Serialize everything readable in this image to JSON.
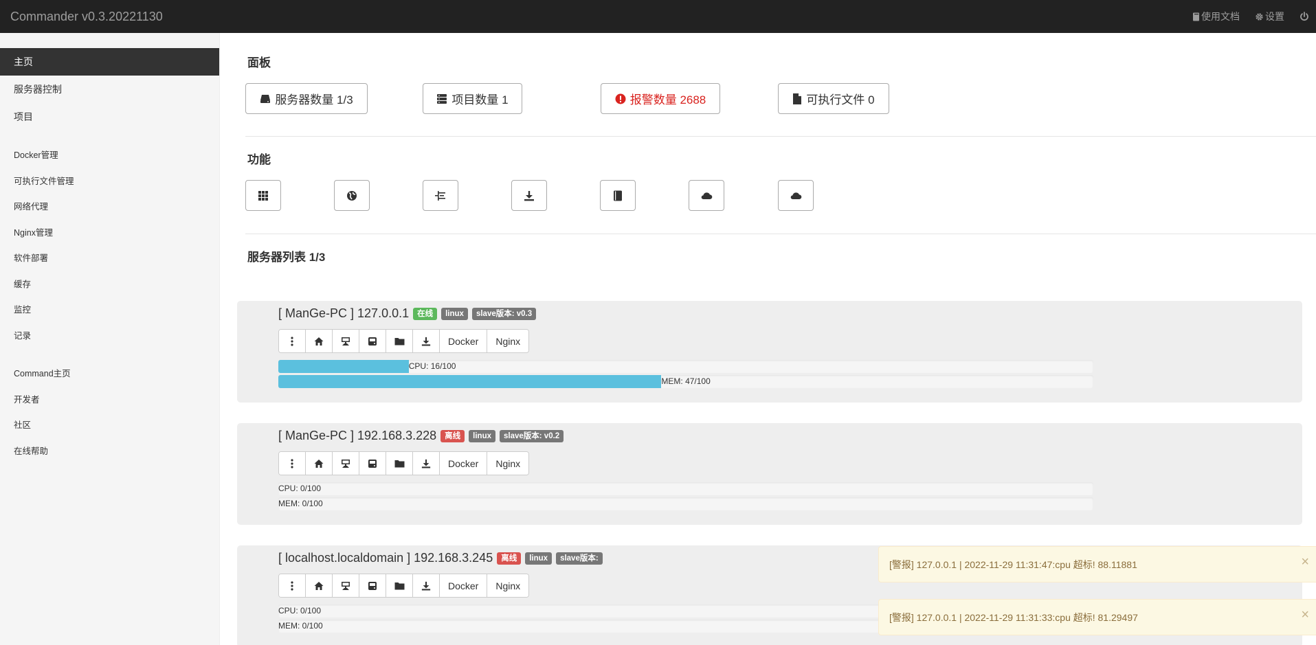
{
  "header": {
    "title": "Commander v0.3.20221130",
    "docs_label": "使用文档",
    "settings_label": "设置"
  },
  "sidebar": {
    "group1": [
      {
        "label": "主页",
        "active": true
      },
      {
        "label": "服务器控制"
      },
      {
        "label": "项目"
      }
    ],
    "group2": [
      {
        "label": "Docker管理"
      },
      {
        "label": "可执行文件管理"
      },
      {
        "label": "网络代理"
      },
      {
        "label": "Nginx管理"
      },
      {
        "label": "软件部署"
      },
      {
        "label": "缓存"
      },
      {
        "label": "监控"
      },
      {
        "label": "记录"
      }
    ],
    "group3": [
      {
        "label": "Command主页"
      },
      {
        "label": "开发者"
      },
      {
        "label": "社区"
      },
      {
        "label": "在线帮助"
      }
    ]
  },
  "dashboard": {
    "title": "面板",
    "stats": [
      {
        "label": "服务器数量 1/3",
        "icon": "server-icon"
      },
      {
        "label": "项目数量 1",
        "icon": "list-icon"
      },
      {
        "label": "报警数量 2688",
        "icon": "alert-circle-icon",
        "color": "#d9231f"
      },
      {
        "label": "可执行文件 0",
        "icon": "file-icon"
      }
    ]
  },
  "functions": {
    "title": "功能",
    "buttons": [
      {
        "icon": "grid-icon"
      },
      {
        "icon": "globe-icon"
      },
      {
        "icon": "tree-icon"
      },
      {
        "icon": "download-icon"
      },
      {
        "icon": "book-icon"
      },
      {
        "icon": "cloud-icon"
      },
      {
        "icon": "cloud-icon"
      }
    ]
  },
  "server_list": {
    "title": "服务器列表 1/3",
    "button_labels": {
      "docker": "Docker",
      "nginx": "Nginx"
    },
    "servers": [
      {
        "name": "[ ManGe-PC ] 127.0.0.1",
        "status": "在线",
        "status_color": "green",
        "os": "linux",
        "slave": "slave版本: v0.3",
        "cpu_label": "CPU: 16/100",
        "cpu": 16,
        "mem_label": "MEM: 47/100",
        "mem": 47
      },
      {
        "name": "[ ManGe-PC ] 192.168.3.228",
        "status": "离线",
        "status_color": "red",
        "os": "linux",
        "slave": "slave版本: v0.2",
        "cpu_label": "CPU: 0/100",
        "cpu": 0,
        "mem_label": "MEM: 0/100",
        "mem": 0
      },
      {
        "name": "[ localhost.localdomain ] 192.168.3.245",
        "status": "离线",
        "status_color": "red",
        "os": "linux",
        "slave": "slave版本:",
        "cpu_label": "CPU: 0/100",
        "cpu": 0,
        "mem_label": "MEM: 0/100",
        "mem": 0
      }
    ]
  },
  "toasts": [
    {
      "text": "[警报] 127.0.0.1 | 2022-11-29 11:31:47:cpu 超标!   88.11881",
      "close": "×"
    },
    {
      "text": "[警报] 127.0.0.1 | 2022-11-29 11:31:33:cpu 超标!   81.29497",
      "close": "×"
    }
  ],
  "colors": {
    "topbar": "#222222",
    "sidebar_active": "#333333",
    "progress": "#5bc0de",
    "alert": "#d9231f",
    "online": "#5cb85c",
    "offline": "#d9534f",
    "toast_bg": "#fcf8e3"
  }
}
